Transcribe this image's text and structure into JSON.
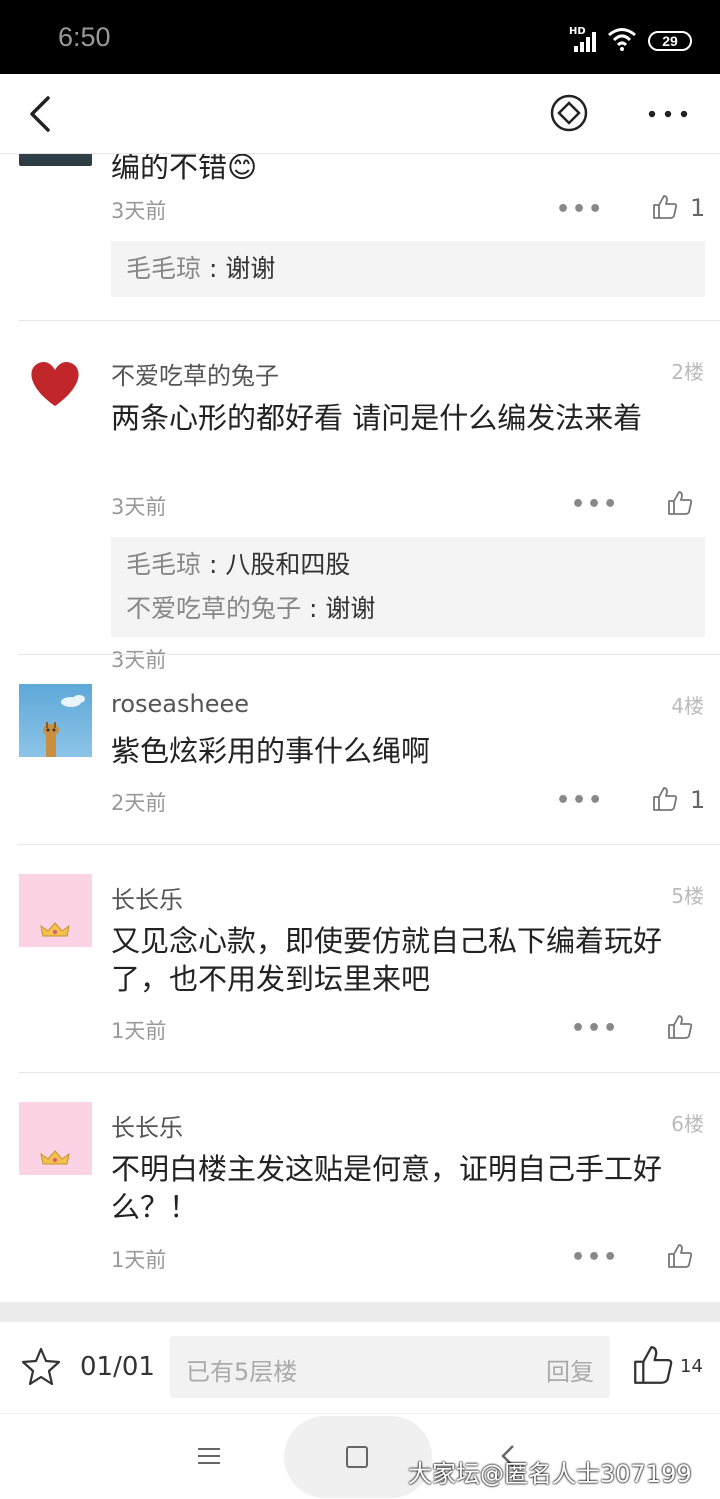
{
  "status_bar": {
    "time": "6:50",
    "network": "HD",
    "battery": "29"
  },
  "top_bar": {
    "back_icon": "chevron-left-icon",
    "share_icon": "diamond-icon",
    "more_icon": "more-dots-icon"
  },
  "posts": [
    {
      "text": "编的不错😊",
      "time": "3天前",
      "likes": "1",
      "replies": [
        {
          "name": "毛毛琼",
          "sep": " : ",
          "text": "谢谢"
        }
      ]
    },
    {
      "username": "不爱吃草的兔子",
      "floor": "2楼",
      "text": "两条心形的都好看 请问是什么编发法来着",
      "time": "3天前",
      "replies": [
        {
          "name": "毛毛琼",
          "sep": " : ",
          "text": "八股和四股"
        },
        {
          "name": "不爱吃草的兔子",
          "sep": " : ",
          "text": "谢谢"
        }
      ]
    },
    {
      "username": "roseasheee",
      "floor": "4楼",
      "text": "紫色炫彩用的事什么绳啊",
      "time": "2天前",
      "likes": "1"
    },
    {
      "username": "长长乐",
      "floor": "5楼",
      "text": "又见念心款，即使要仿就自己私下编着玩好了，也不用发到坛里来吧",
      "time": "1天前"
    },
    {
      "username": "长长乐",
      "floor": "6楼",
      "text": "不明白楼主发这贴是何意，证明自己手工好么？！",
      "time": "1天前"
    }
  ],
  "more_label": "•••",
  "bottom_bar": {
    "pager": "01/01",
    "placeholder": "已有5层楼",
    "reply_button": "回复",
    "like_count": "14"
  },
  "watermark": "大家坛@匿名人士307199",
  "colors": {
    "accent": "#222222",
    "divider": "#e8e8e8",
    "reply_bg": "#f4f4f4"
  }
}
